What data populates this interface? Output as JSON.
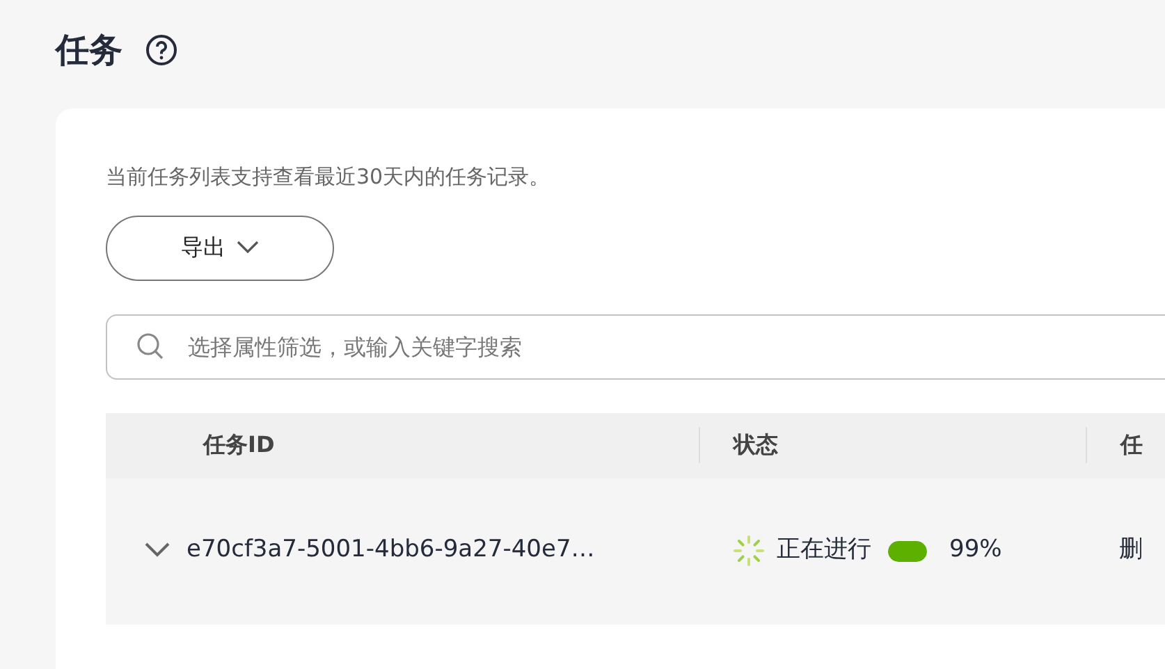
{
  "page": {
    "title": "任务"
  },
  "notice": "当前任务列表支持查看最近30天内的任务记录。",
  "export_button": {
    "label": "导出"
  },
  "search": {
    "placeholder": "选择属性筛选，或输入关键字搜索"
  },
  "table": {
    "columns": [
      "任务ID",
      "状态",
      "任"
    ],
    "rows": [
      {
        "expanded": false,
        "task_id": "e70cf3a7-5001-4bb6-9a27-40e7…",
        "status": "正在进行",
        "level": 0.99,
        "percent": "99%",
        "column_3": "删"
      }
    ]
  }
}
